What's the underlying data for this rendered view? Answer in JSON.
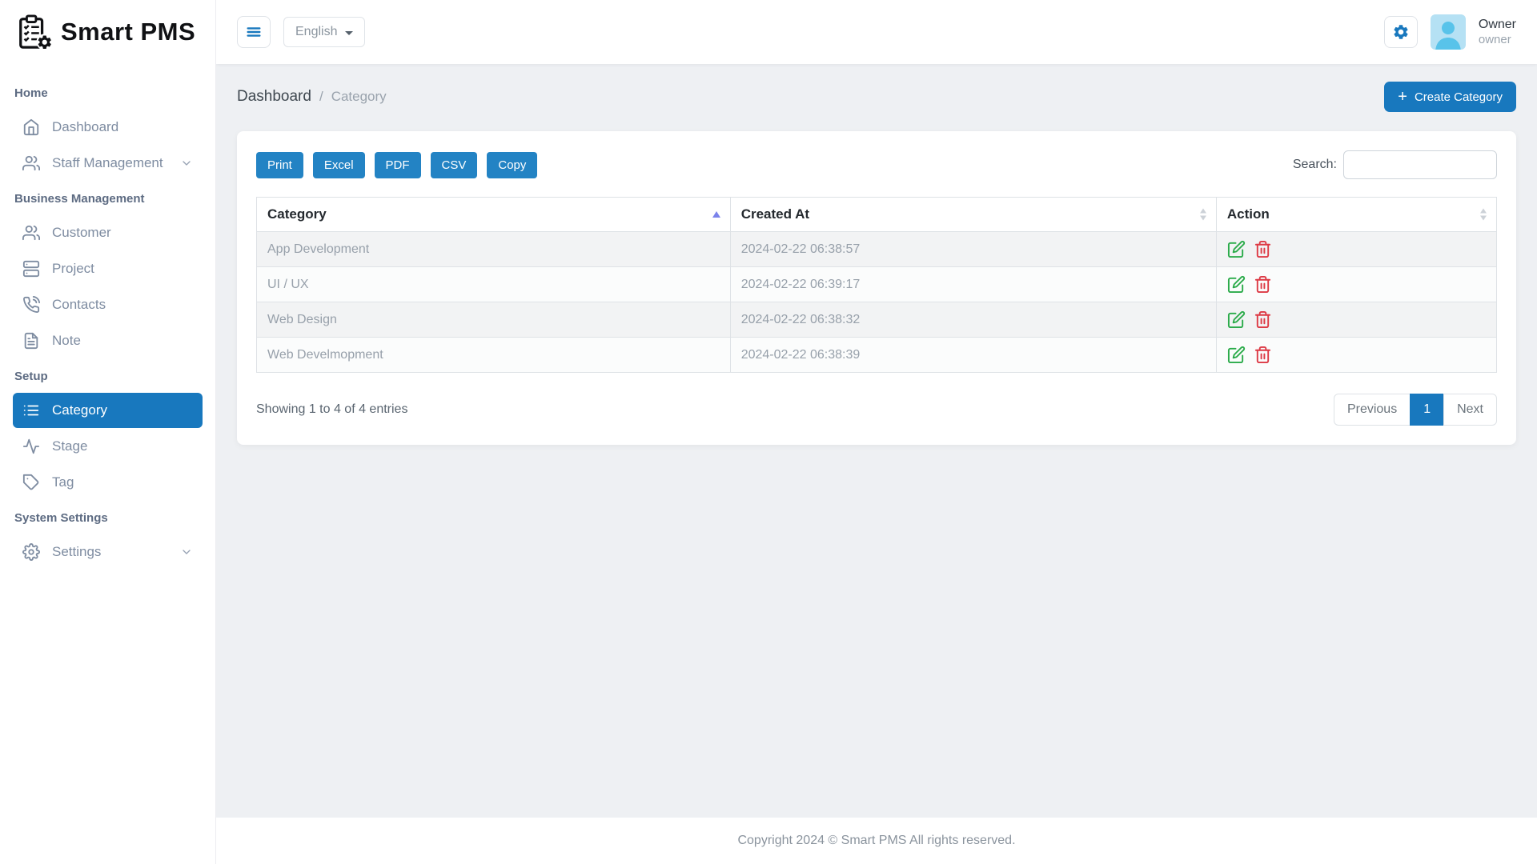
{
  "app_name": "Smart PMS",
  "topbar": {
    "language": "English",
    "user_name": "Owner",
    "user_role": "owner"
  },
  "sidebar": {
    "sections": [
      {
        "label": "Home",
        "items": [
          {
            "label": "Dashboard"
          },
          {
            "label": "Staff Management"
          }
        ]
      },
      {
        "label": "Business Management",
        "items": [
          {
            "label": "Customer"
          },
          {
            "label": "Project"
          },
          {
            "label": "Contacts"
          },
          {
            "label": "Note"
          }
        ]
      },
      {
        "label": "Setup",
        "items": [
          {
            "label": "Category"
          },
          {
            "label": "Stage"
          },
          {
            "label": "Tag"
          }
        ]
      },
      {
        "label": "System Settings",
        "items": [
          {
            "label": "Settings"
          }
        ]
      }
    ]
  },
  "breadcrumb": {
    "parent": "Dashboard",
    "separator": "/",
    "current": "Category"
  },
  "actions": {
    "create_button": "Create Category",
    "plus_icon": "+"
  },
  "datatable": {
    "export_buttons": [
      "Print",
      "Excel",
      "PDF",
      "CSV",
      "Copy"
    ],
    "search_label": "Search:",
    "search_value": "",
    "columns": {
      "category": "Category",
      "created_at": "Created At",
      "action": "Action"
    },
    "sort": {
      "column": "Category",
      "direction": "asc"
    },
    "rows": [
      {
        "category": "App Development",
        "created_at": "2024-02-22 06:38:57"
      },
      {
        "category": "UI / UX",
        "created_at": "2024-02-22 06:39:17"
      },
      {
        "category": "Web Design",
        "created_at": "2024-02-22 06:38:32"
      },
      {
        "category": "Web Develmopment",
        "created_at": "2024-02-22 06:38:39"
      }
    ],
    "info": "Showing 1 to 4 of 4 entries",
    "pagination": {
      "previous": "Previous",
      "page": "1",
      "next": "Next"
    }
  },
  "footer": {
    "copyright": "Copyright 2024 © Smart PMS All rights reserved."
  },
  "colors": {
    "primary": "#1878be",
    "edit_icon": "#2bab4a",
    "delete_icon": "#dd3a45",
    "sort_active": "#7b83eb",
    "avatar_bg": "#b5e1f4",
    "avatar_fg": "#58c3ea"
  }
}
